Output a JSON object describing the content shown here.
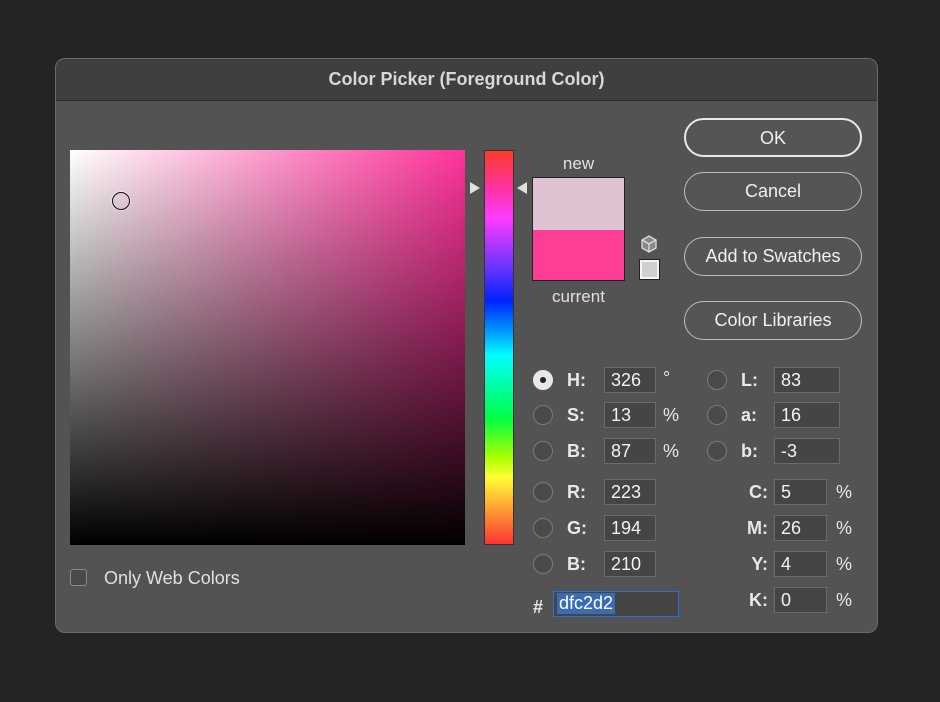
{
  "title": "Color Picker (Foreground Color)",
  "colors": {
    "new": "#dfc2d2",
    "current": "#fe3d94",
    "hue_base": "#ff3399"
  },
  "swatch": {
    "new_label": "new",
    "current_label": "current"
  },
  "buttons": {
    "ok": "OK",
    "cancel": "Cancel",
    "add_to_swatches": "Add to Swatches",
    "color_libraries": "Color Libraries"
  },
  "only_web_colors": {
    "label": "Only Web Colors",
    "checked": false
  },
  "hsb": {
    "h_label": "H:",
    "h": "326",
    "h_unit": "°",
    "s_label": "S:",
    "s": "13",
    "s_unit": "%",
    "b_label": "B:",
    "b": "87",
    "b_unit": "%"
  },
  "rgb": {
    "r_label": "R:",
    "r": "223",
    "g_label": "G:",
    "g": "194",
    "b_label": "B:",
    "b": "210"
  },
  "lab": {
    "l_label": "L:",
    "l": "83",
    "a_label": "a:",
    "a": "16",
    "b_label": "b:",
    "b": "-3"
  },
  "cmyk": {
    "c_label": "C:",
    "c": "5",
    "m_label": "M:",
    "m": "26",
    "y_label": "Y:",
    "y": "4",
    "k_label": "K:",
    "k": "0",
    "unit": "%"
  },
  "hex": {
    "label": "#",
    "value": "dfc2d2"
  },
  "selected_mode": "H"
}
